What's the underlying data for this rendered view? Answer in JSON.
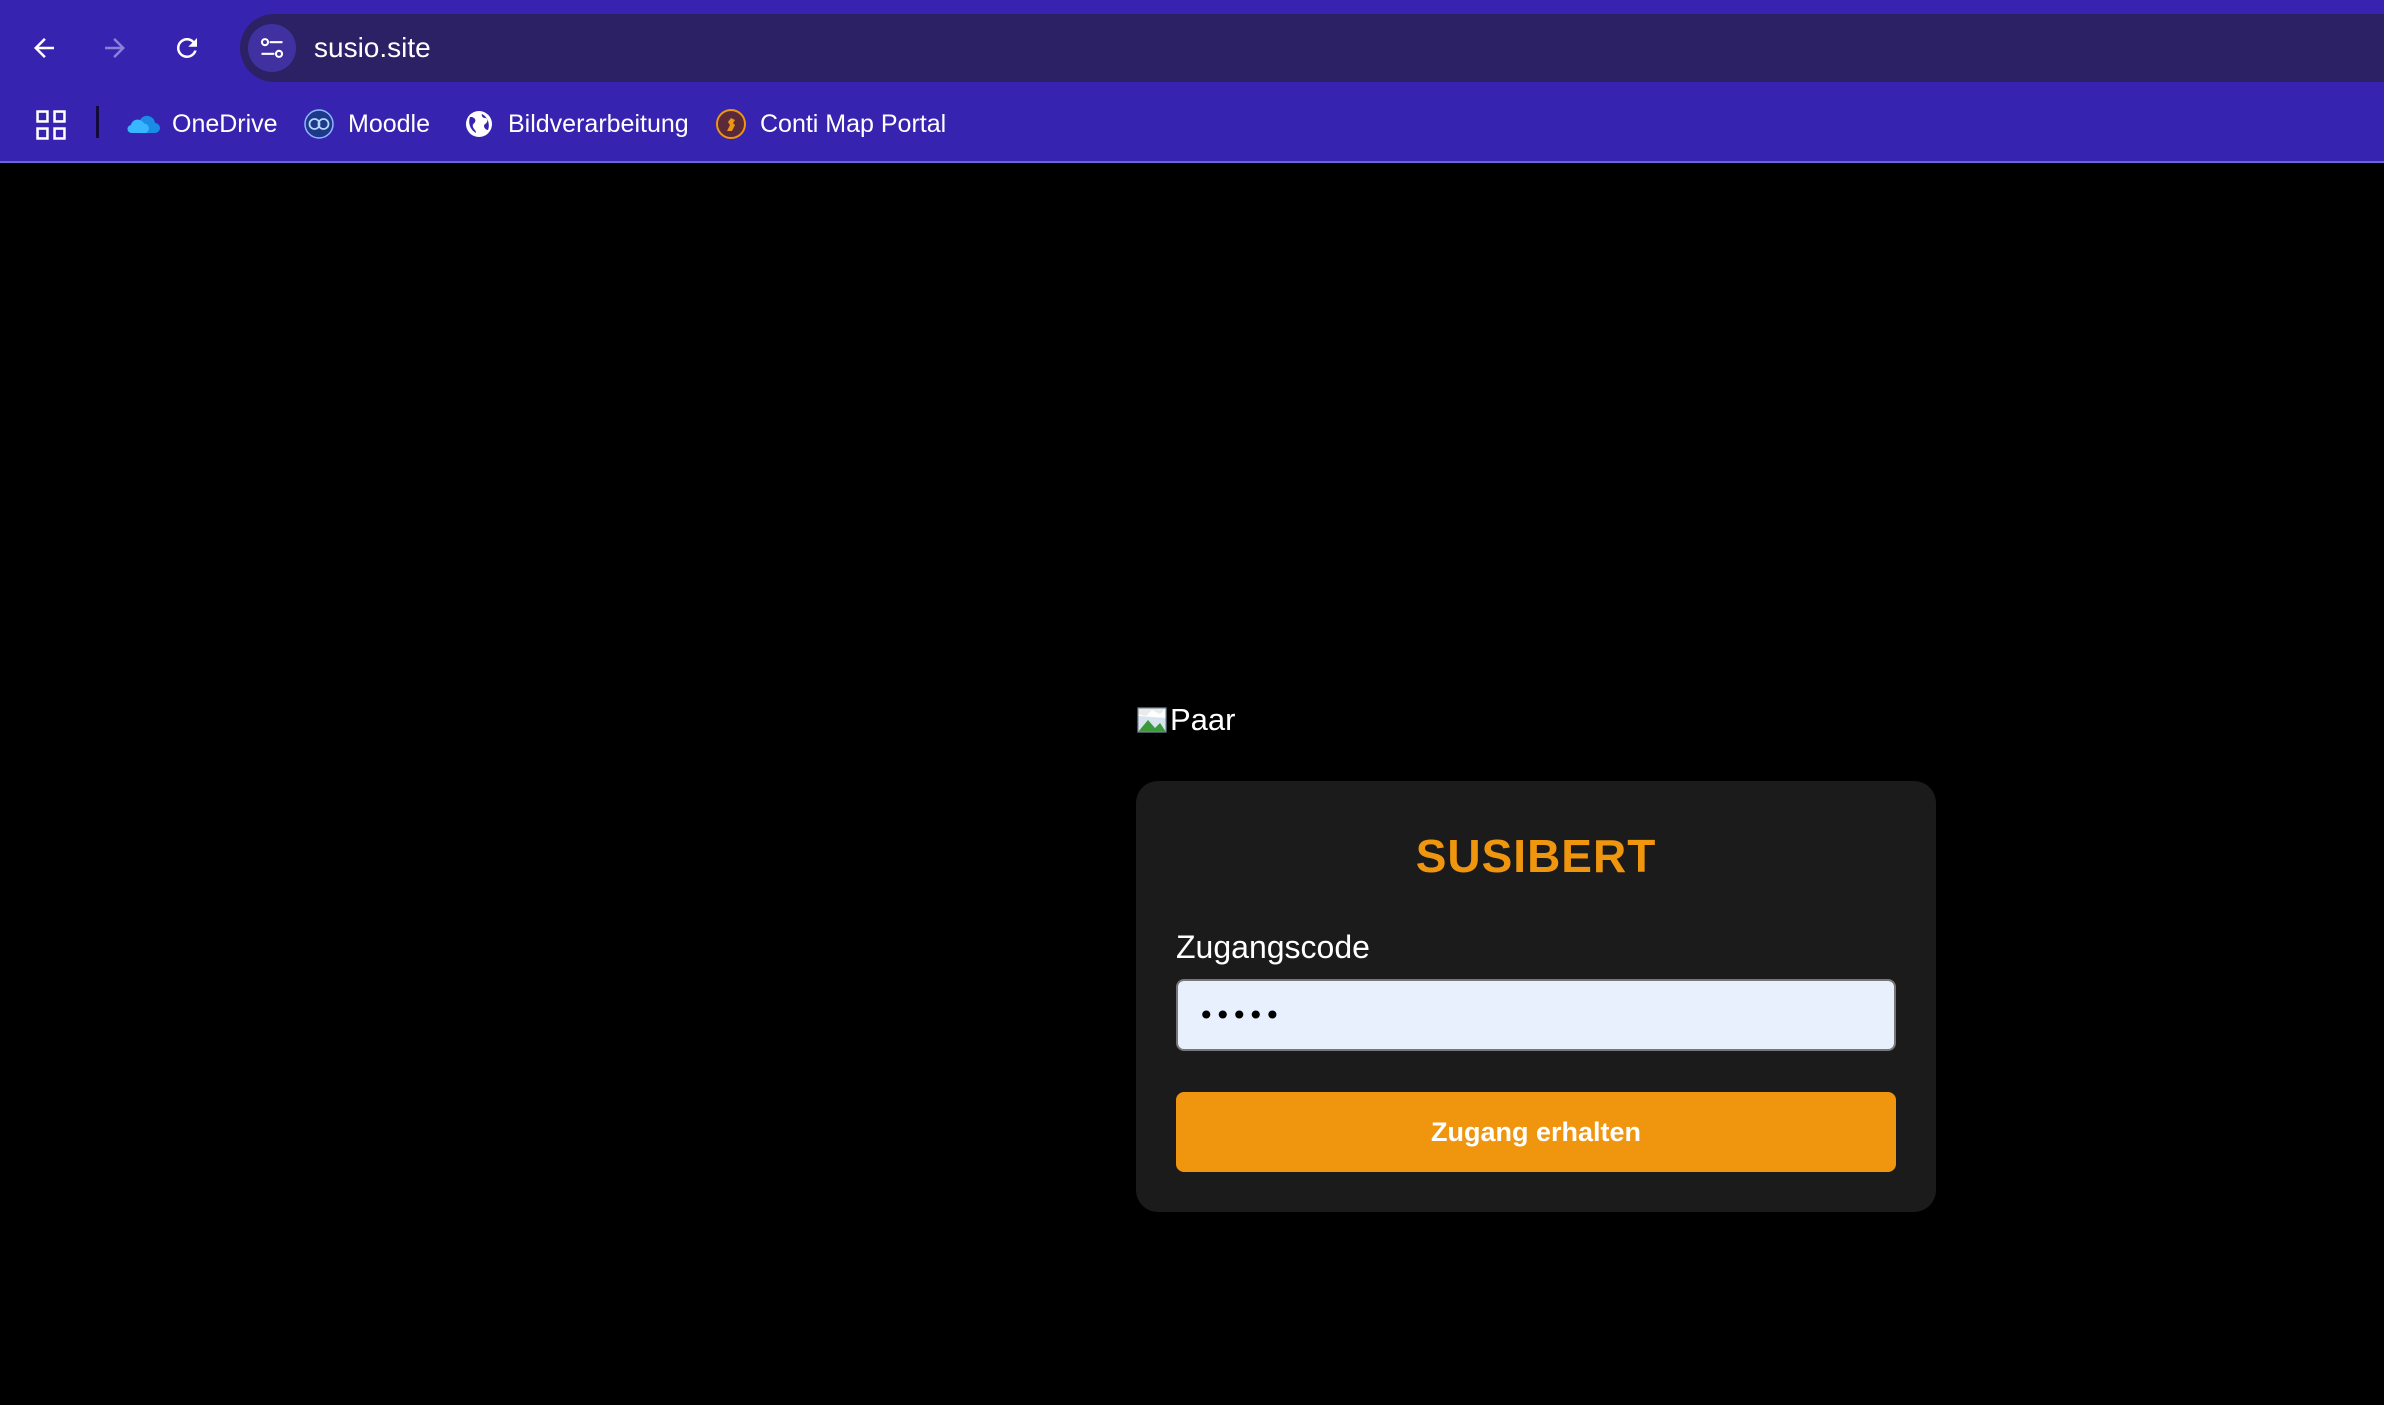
{
  "browser": {
    "url": "susio.site",
    "nav": {
      "back_icon": "arrow-left-icon",
      "forward_icon": "arrow-right-icon",
      "reload_icon": "reload-icon",
      "site_info_icon": "tune-icon"
    },
    "bookmarks": [
      {
        "label": "OneDrive",
        "icon": "onedrive-cloud-icon"
      },
      {
        "label": "Moodle",
        "icon": "moodle-icon"
      },
      {
        "label": "Bildverarbeitung",
        "icon": "globe-icon"
      },
      {
        "label": "Conti Map Portal",
        "icon": "conti-horse-icon"
      }
    ],
    "apps_icon": "apps-grid-icon"
  },
  "page": {
    "image_alt": "Paar",
    "card": {
      "title": "SUSIBERT",
      "field_label": "Zugangscode",
      "input_value": "•••••",
      "button_label": "Zugang erhalten"
    }
  },
  "colors": {
    "chrome_bg": "#3623b0",
    "omnibox_bg": "#2d2166",
    "page_bg": "#000000",
    "card_bg": "#1b1b1b",
    "accent": "#f0950e",
    "input_bg": "#e8f0fe"
  }
}
